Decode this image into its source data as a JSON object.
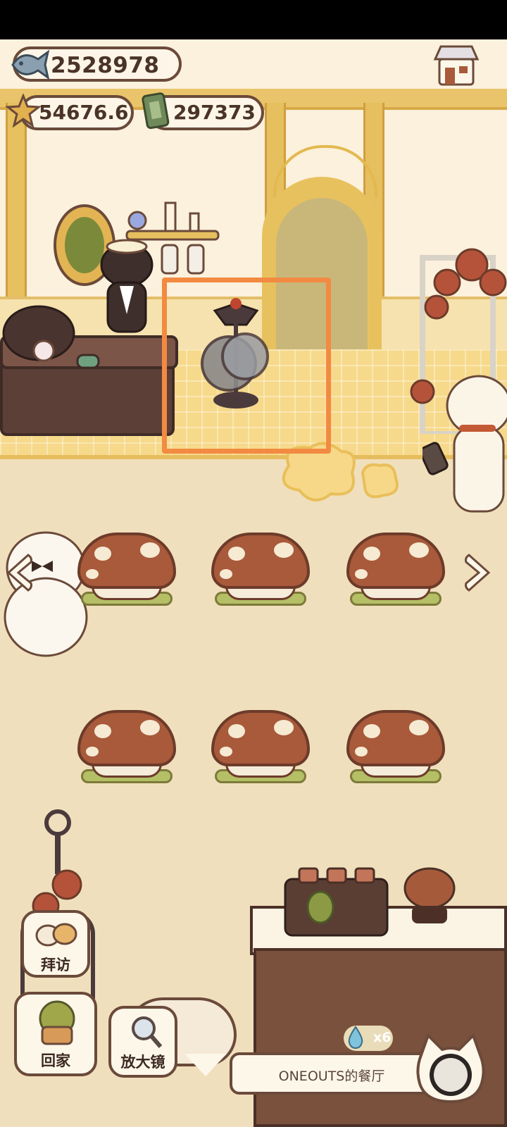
{
  "currency": {
    "fish": "2528978",
    "stars": "54676.6",
    "tickets": "297373"
  },
  "buttons": {
    "visit": "拜访",
    "home": "回家",
    "magnifier": "放大镜"
  },
  "restaurant": {
    "name": "ONEOUTS的餐厅",
    "water_drops": "x6"
  },
  "icons": {
    "fish": "fish-icon",
    "star": "star-icon",
    "ticket": "ticket-icon",
    "shop": "shop-icon",
    "left": "chevron-left-icon",
    "right": "chevron-right-icon",
    "down": "chevron-down-icon",
    "drop": "water-drop-icon"
  },
  "colors": {
    "highlight": "#f28a42",
    "mushroom_cap": "#a85a3a",
    "outline": "#6b4a3a"
  }
}
